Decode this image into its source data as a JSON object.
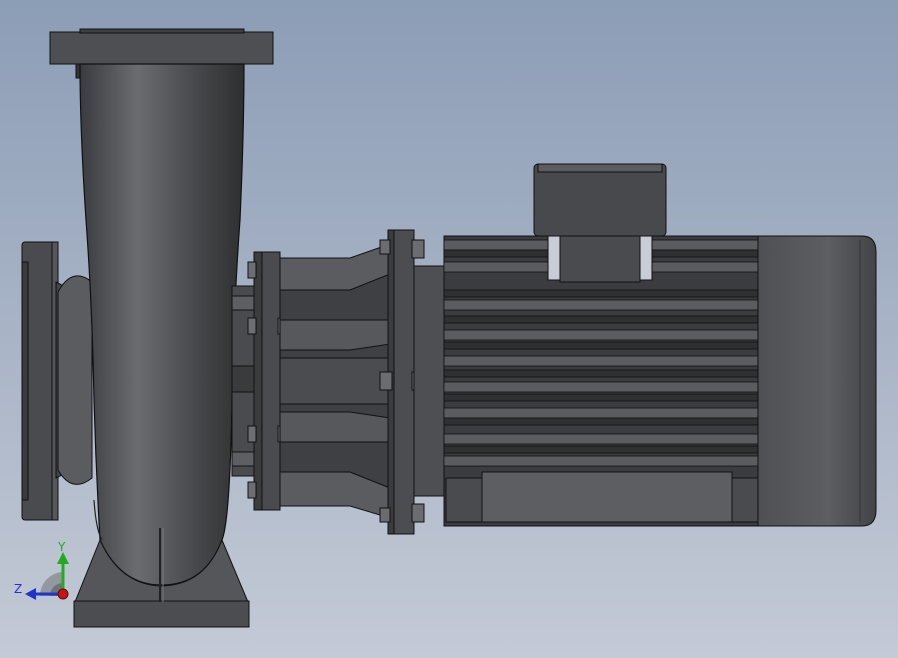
{
  "view": {
    "background_top": "#8c9db6",
    "background_bottom": "#c4cad6",
    "part_color_dark": "#3c3d40",
    "part_color_mid": "#55575b",
    "part_color_light": "#6e7073",
    "edge_color": "#111111"
  },
  "triad": {
    "y_label": "Y",
    "z_label": "Z",
    "y_color": "#22aa22",
    "z_color": "#2233cc",
    "origin_color": "#cc1111"
  }
}
